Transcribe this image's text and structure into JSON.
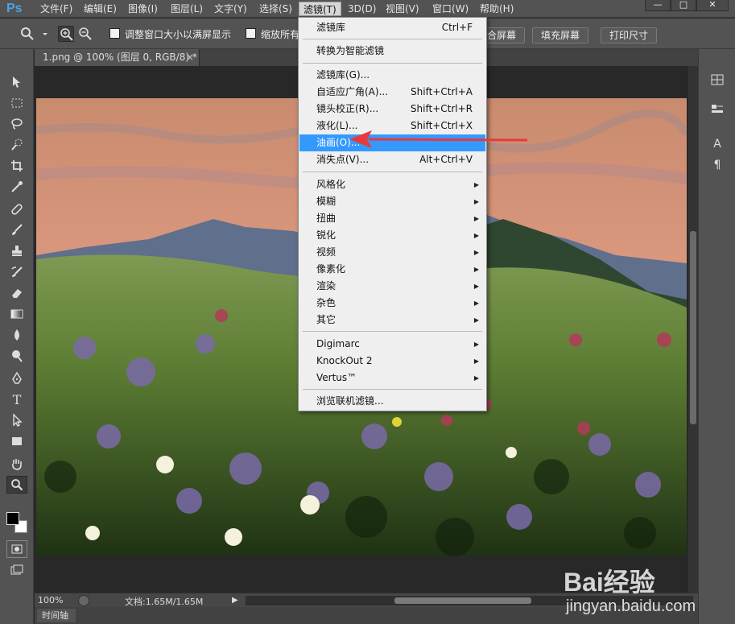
{
  "app": {
    "logo": "Ps"
  },
  "menubar": {
    "items": [
      "文件(F)",
      "编辑(E)",
      "图像(I)",
      "图层(L)",
      "文字(Y)",
      "选择(S)",
      "滤镜(T)",
      "3D(D)",
      "视图(V)",
      "窗口(W)",
      "帮助(H)"
    ],
    "active_index": 6,
    "window_buttons": [
      "—",
      "□",
      "✕"
    ]
  },
  "options_bar": {
    "resize_windows_label": "调整窗口大小以满屏显示",
    "zoom_all_label": "缩放所有",
    "fit_screen_partial": "合屏幕",
    "fill_screen": "填充屏幕",
    "print_size": "打印尺寸"
  },
  "document": {
    "tab_title": "1.png @ 100% (图层 0, RGB/8) *",
    "tab_close": "×"
  },
  "status": {
    "zoom": "100%",
    "doc_info": "文档:1.65M/1.65M"
  },
  "timeline": {
    "tab_label": "时间轴"
  },
  "filter_menu": {
    "items": [
      {
        "label": "滤镜库",
        "shortcut": "Ctrl+F"
      },
      {
        "label": "转换为智能滤镜",
        "shortcut": ""
      },
      {
        "label": "滤镜库(G)...",
        "shortcut": ""
      },
      {
        "label": "自适应广角(A)...",
        "shortcut": "Shift+Ctrl+A"
      },
      {
        "label": "镜头校正(R)...",
        "shortcut": "Shift+Ctrl+R"
      },
      {
        "label": "液化(L)...",
        "shortcut": "Shift+Ctrl+X"
      },
      {
        "label": "油画(O)...",
        "shortcut": "",
        "highlighted": true
      },
      {
        "label": "消失点(V)...",
        "shortcut": "Alt+Ctrl+V"
      },
      {
        "label": "风格化",
        "submenu": true
      },
      {
        "label": "模糊",
        "submenu": true
      },
      {
        "label": "扭曲",
        "submenu": true
      },
      {
        "label": "锐化",
        "submenu": true
      },
      {
        "label": "视频",
        "submenu": true
      },
      {
        "label": "像素化",
        "submenu": true
      },
      {
        "label": "渲染",
        "submenu": true
      },
      {
        "label": "杂色",
        "submenu": true
      },
      {
        "label": "其它",
        "submenu": true
      },
      {
        "label": "Digimarc",
        "submenu": true
      },
      {
        "label": "KnockOut 2",
        "submenu": true
      },
      {
        "label": "Vertus™",
        "submenu": true
      },
      {
        "label": "浏览联机滤镜...",
        "shortcut": ""
      }
    ]
  },
  "watermark": {
    "brand": "Bai经验",
    "url": "jingyan.baidu.com"
  },
  "colors": {
    "highlight": "#3399ff",
    "annotation_arrow": "#e8393d",
    "ps_logo": "#4aa3e6"
  }
}
